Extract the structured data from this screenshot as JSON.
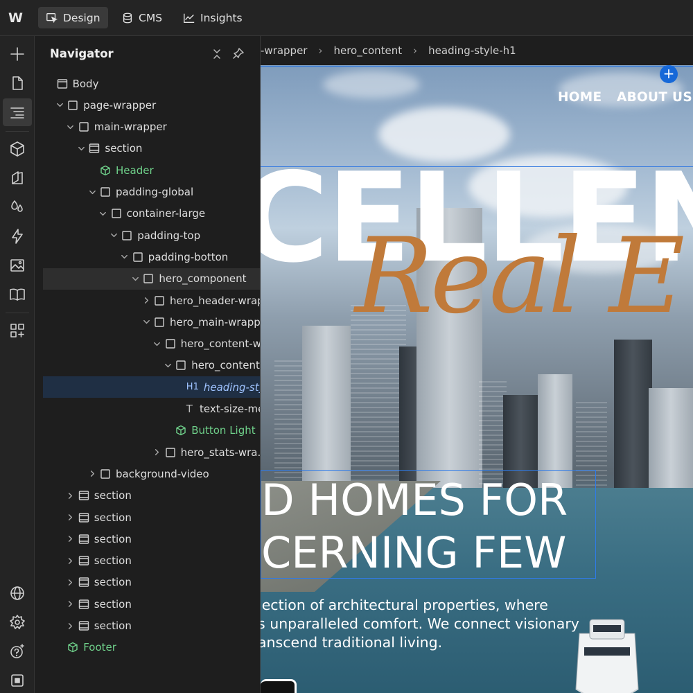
{
  "topbar": {
    "logo": "W",
    "modes": [
      {
        "label": "Design",
        "icon": "cursor-box-icon",
        "active": true
      },
      {
        "label": "CMS",
        "icon": "database-icon",
        "active": false
      },
      {
        "label": "Insights",
        "icon": "chart-line-icon",
        "active": false
      }
    ]
  },
  "rail": {
    "items": [
      "add-icon",
      "page-icon",
      "navigator-icon",
      "components-icon",
      "styles-icon",
      "variables-icon",
      "interactions-icon",
      "assets-icon",
      "library-icon",
      "apps-icon"
    ],
    "bottom": [
      "globe-icon",
      "settings-icon",
      "help-icon",
      "stop-icon"
    ]
  },
  "navigator": {
    "title": "Navigator",
    "tree": [
      {
        "label": "Body",
        "caret": "none"
      },
      {
        "label": "page-wrapper",
        "caret": "open"
      },
      {
        "label": "main-wrapper",
        "caret": "open"
      },
      {
        "label": "section",
        "caret": "open"
      },
      {
        "label": "Header",
        "caret": "none"
      },
      {
        "label": "padding-global",
        "caret": "open"
      },
      {
        "label": "container-large",
        "caret": "open"
      },
      {
        "label": "padding-top",
        "caret": "open"
      },
      {
        "label": "padding-botton",
        "caret": "open"
      },
      {
        "label": "hero_component",
        "caret": "open"
      },
      {
        "label": "hero_header-wrapp",
        "caret": "closed"
      },
      {
        "label": "hero_main-wrapper",
        "caret": "open"
      },
      {
        "label": "hero_content-w...",
        "caret": "open"
      },
      {
        "label": "hero_content",
        "caret": "open"
      },
      {
        "label": "heading-styl",
        "caret": "none",
        "tag": "H1"
      },
      {
        "label": "text-size-me",
        "caret": "none",
        "tag": "T"
      },
      {
        "label": "Button Light",
        "caret": "none"
      },
      {
        "label": "hero_stats-wra...",
        "caret": "closed"
      },
      {
        "label": "background-video",
        "caret": "closed"
      },
      {
        "label": "section",
        "caret": "closed"
      },
      {
        "label": "section",
        "caret": "closed"
      },
      {
        "label": "section",
        "caret": "closed"
      },
      {
        "label": "section",
        "caret": "closed"
      },
      {
        "label": "section",
        "caret": "closed"
      },
      {
        "label": "section",
        "caret": "closed"
      },
      {
        "label": "section",
        "caret": "closed"
      },
      {
        "label": "Footer",
        "caret": "none"
      }
    ]
  },
  "canvas": {
    "breadcrumbs": [
      "-wrapper",
      "hero_content",
      "heading-style-h1"
    ],
    "site_nav": [
      "HOME",
      "ABOUT US"
    ],
    "hero_word": "CELLEN",
    "hero_script": "Real E",
    "sub_heading": [
      "D HOMES FOR",
      "CERNING FEW"
    ],
    "paragraph": [
      "lection of architectural properties, where",
      "s unparalleled comfort. We connect visionary",
      "anscend traditional living."
    ],
    "add_badge": "+"
  },
  "colors": {
    "accent": "#1e6fe0",
    "component": "#6fd08a",
    "script": "#c07a3a",
    "selected_row": "#1f2f44"
  }
}
